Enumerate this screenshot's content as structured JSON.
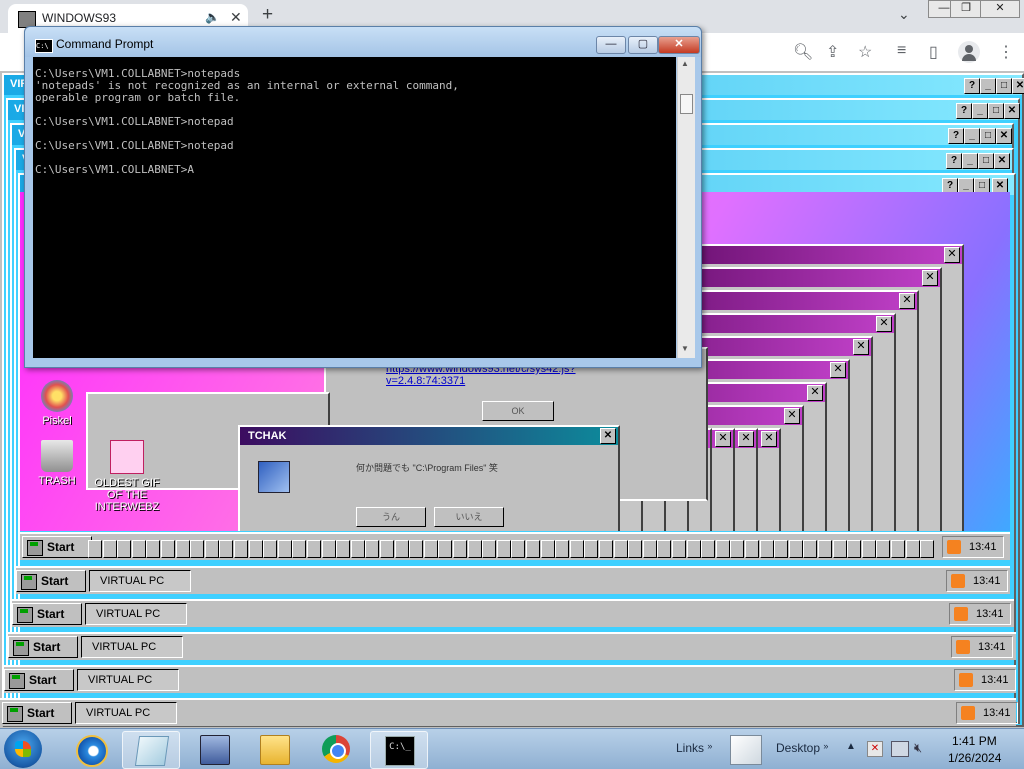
{
  "browser": {
    "tab_title": "WINDOWS93",
    "tab_icons": {
      "audio": "speaker-icon",
      "close": "close-icon"
    },
    "new_tab_symbol": "+",
    "toolbar_icons": [
      "zoom-icon",
      "share-icon",
      "bookmark-star-icon",
      "media-queue-icon",
      "side-panel-icon",
      "profile-icon",
      "more-menu-icon"
    ]
  },
  "virtual_pc": {
    "window_title": "VIRTUAL PC",
    "desktop_icons": [
      {
        "label": "Piskel",
        "icon": "palette-icon"
      },
      {
        "label": "TRASH",
        "icon": "trash-icon"
      },
      {
        "label": "OLDEST GIF OF THE INTERWEBZ",
        "icon": "gif-icon"
      }
    ],
    "bg_link": {
      "text_1": "https://www.windows93.net/c/sys42.js?",
      "text_2": "v=2.4.8:74:3371",
      "ok_label": "OK"
    },
    "tchak_dialog": {
      "title": "TCHAK",
      "message": "何か問題でも \"C:\\Program Files\" 笑",
      "yes_label": "うん",
      "no_label": "いいえ"
    },
    "taskbar": {
      "start_label": "Start",
      "task_label": "VIRTUAL PC",
      "clock": "13:41"
    },
    "colors": {
      "desktop_pink": "#ff28ff",
      "title_cyan": "#3fd0ff",
      "taskbar_gray": "#c0c0c0"
    }
  },
  "cmd": {
    "title": "Command Prompt",
    "icon_text": "C:\\",
    "lines": [
      "C:\\Users\\VM1.COLLABNET>notepads",
      "'notepads' is not recognized as an internal or external command,",
      "operable program or batch file.",
      "",
      "C:\\Users\\VM1.COLLABNET>notepad",
      "",
      "C:\\Users\\VM1.COLLABNET>notepad",
      "",
      "C:\\Users\\VM1.COLLABNET>A"
    ]
  },
  "windows_taskbar": {
    "pinned": [
      {
        "name": "internet-explorer-icon"
      },
      {
        "name": "notepad-icon"
      },
      {
        "name": "network-computer-icon"
      },
      {
        "name": "file-explorer-icon"
      },
      {
        "name": "chrome-icon"
      },
      {
        "name": "cmd-icon",
        "active": true
      }
    ],
    "links_label": "Links",
    "desktop_label": "Desktop",
    "time": "1:41 PM",
    "date": "1/26/2024"
  }
}
